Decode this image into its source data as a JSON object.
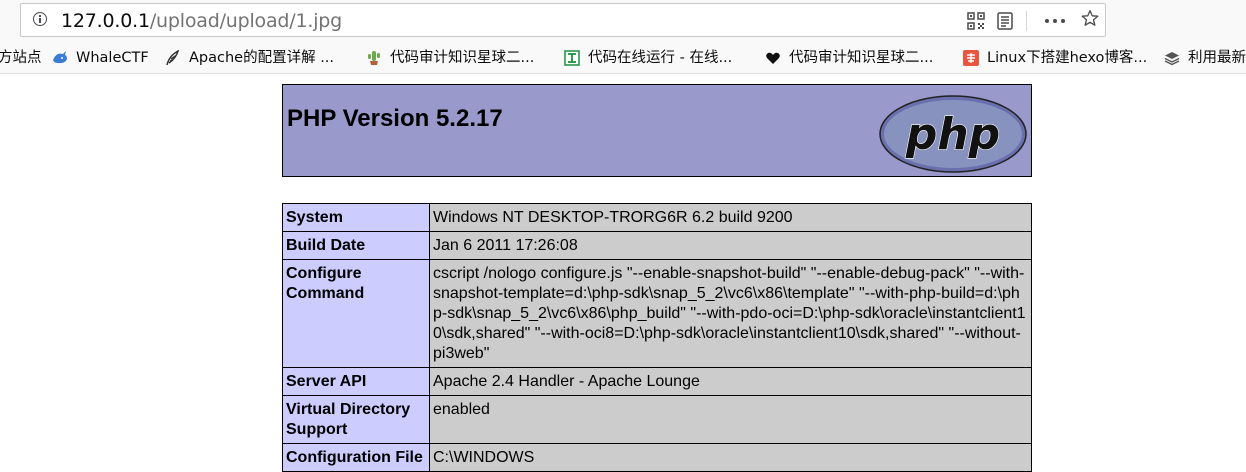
{
  "browser": {
    "url_host": "127.0.0.1",
    "url_path": "/upload/upload/1.jpg",
    "icons": [
      "info-icon",
      "qr-code-icon",
      "reader-view-icon",
      "more-icon",
      "star-icon"
    ],
    "bookmarks": [
      {
        "label": "方站点",
        "icon": "none"
      },
      {
        "label": "WhaleCTF",
        "icon": "whale-icon"
      },
      {
        "label": "Apache的配置详解 ...",
        "icon": "feather-icon"
      },
      {
        "label": "代码审计知识星球二...",
        "icon": "cactus-icon"
      },
      {
        "label": "代码在线运行 - 在线...",
        "icon": "tool-icon"
      },
      {
        "label": "代码审计知识星球二...",
        "icon": "heart-icon"
      },
      {
        "label": "Linux下搭建hexo博客...",
        "icon": "jian-icon"
      },
      {
        "label": "利用最新",
        "icon": "stack-icon"
      }
    ]
  },
  "phpinfo": {
    "title": "PHP Version 5.2.17",
    "logo_text": "php",
    "colors": {
      "header_bg": "#9999cc",
      "key_bg": "#ccccff",
      "value_bg": "#cccccc"
    },
    "rows": [
      {
        "key": "System",
        "value": "Windows NT DESKTOP-TRORG6R 6.2 build 9200"
      },
      {
        "key": "Build Date",
        "value": "Jan 6 2011 17:26:08"
      },
      {
        "key": "Configure Command",
        "value": "cscript /nologo configure.js \"--enable-snapshot-build\" \"--enable-debug-pack\" \"--with-snapshot-template=d:\\php-sdk\\snap_5_2\\vc6\\x86\\template\" \"--with-php-build=d:\\php-sdk\\snap_5_2\\vc6\\x86\\php_build\" \"--with-pdo-oci=D:\\php-sdk\\oracle\\instantclient10\\sdk,shared\" \"--with-oci8=D:\\php-sdk\\oracle\\instantclient10\\sdk,shared\" \"--without-pi3web\""
      },
      {
        "key": "Server API",
        "value": "Apache 2.4 Handler - Apache Lounge"
      },
      {
        "key": "Virtual Directory Support",
        "value": "enabled"
      },
      {
        "key": "Configuration File",
        "value": "C:\\WINDOWS"
      }
    ]
  }
}
